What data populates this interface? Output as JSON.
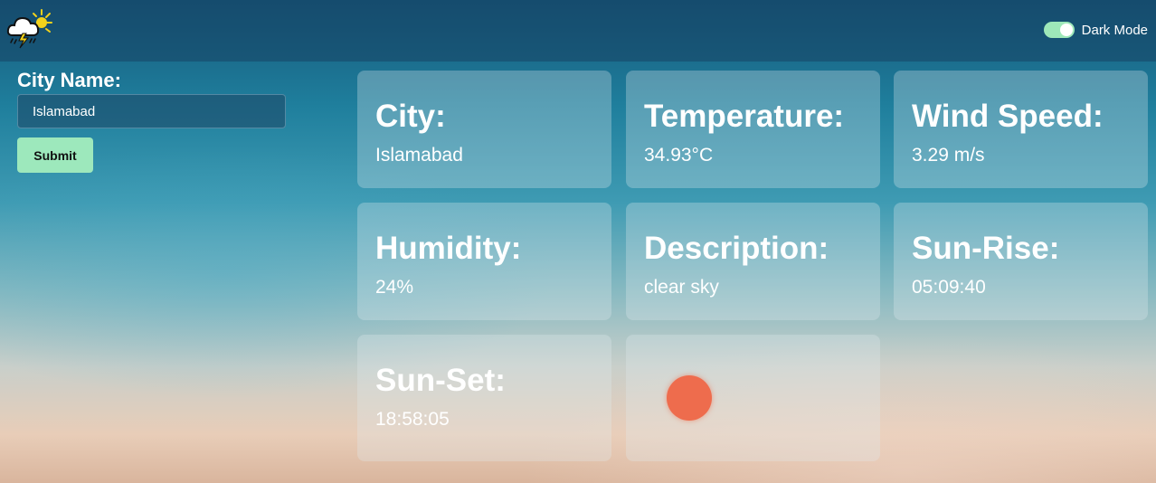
{
  "header": {
    "logo_icon": "thunderstorm-sun-icon",
    "dark_mode_label": "Dark Mode",
    "dark_mode_on": true,
    "toggle_color": "#9ee8b9"
  },
  "form": {
    "city_label": "City Name:",
    "city_value": "Islamabad",
    "submit_label": "Submit",
    "submit_color": "#9de8bc"
  },
  "cards": [
    {
      "title": "City:",
      "value": "Islamabad"
    },
    {
      "title": "Temperature:",
      "value": "34.93°C"
    },
    {
      "title": "Wind Speed:",
      "value": "3.29 m/s"
    },
    {
      "title": "Humidity:",
      "value": "24%"
    },
    {
      "title": "Description:",
      "value": "clear sky"
    },
    {
      "title": "Sun-Rise:",
      "value": "05:09:40"
    },
    {
      "title": "Sun-Set:",
      "value": "18:58:05"
    }
  ],
  "weather_icon": {
    "name": "sun-icon",
    "color": "#ee6c4d"
  }
}
